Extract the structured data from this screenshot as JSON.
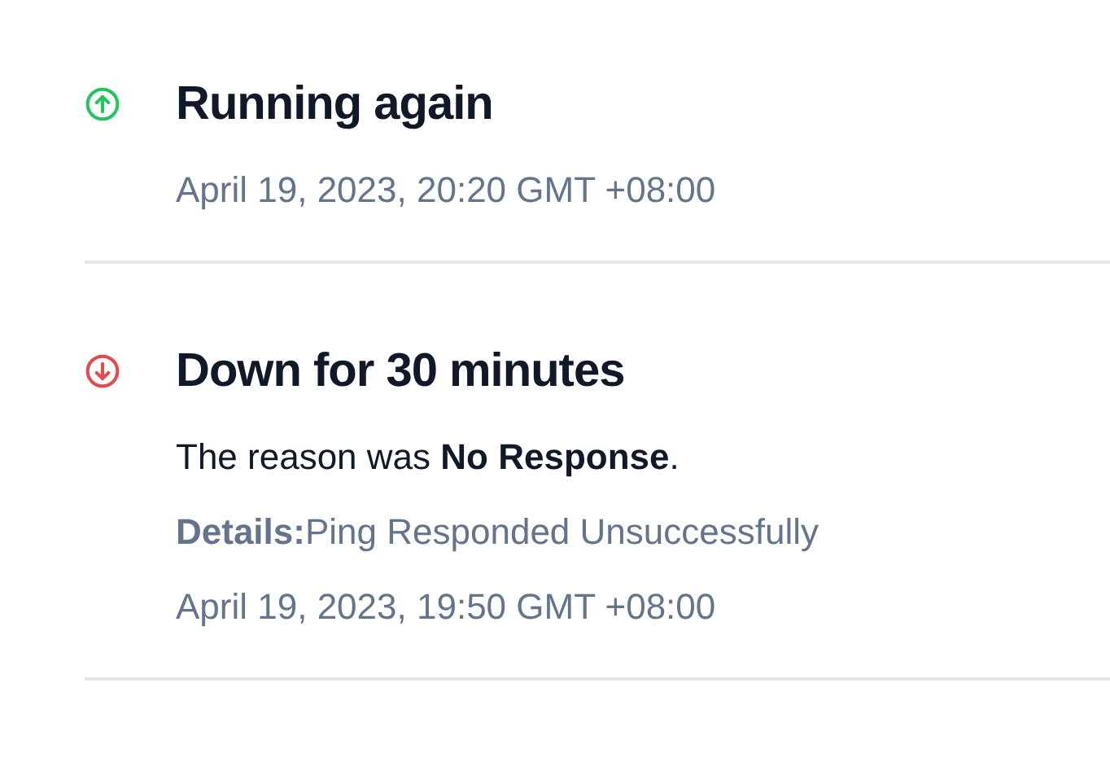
{
  "events": [
    {
      "kind": "up",
      "title": "Running again",
      "time": "April 19, 2023, 20:20 GMT +08:00"
    },
    {
      "kind": "down",
      "title": "Down for 30 minutes",
      "reason": "The reason was **No Response**.",
      "details": "**Details:**Ping Responded Unsuccessfully",
      "time": "April 19, 2023, 19:50 GMT +08:00"
    }
  ]
}
